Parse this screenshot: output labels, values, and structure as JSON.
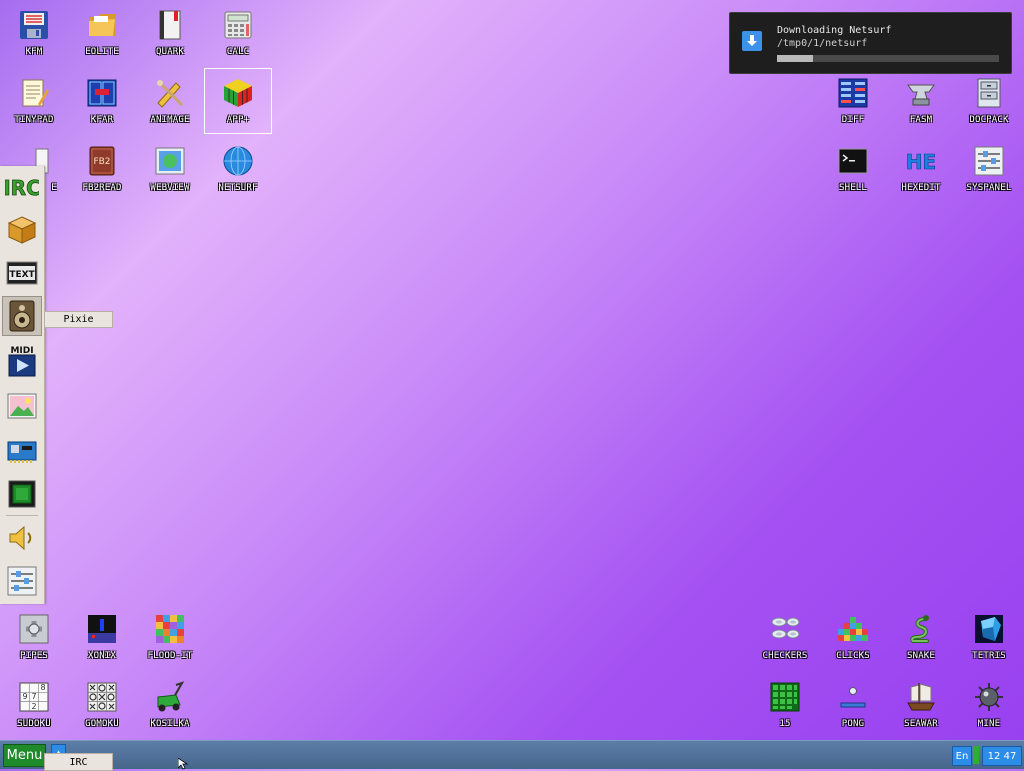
{
  "desktop": {
    "top_left": [
      {
        "label": "KFM",
        "icon": "floppy-icon"
      },
      {
        "label": "EOLITE",
        "icon": "folder-icon"
      },
      {
        "label": "QUARK",
        "icon": "book-icon"
      },
      {
        "label": "CALC",
        "icon": "calculator-icon"
      },
      {
        "label": "TINYPAD",
        "icon": "notepad-icon"
      },
      {
        "label": "KFAR",
        "icon": "panels-icon"
      },
      {
        "label": "ANIMAGE",
        "icon": "pencil-icon"
      },
      {
        "label": "APP+",
        "icon": "rubik-cube-icon"
      },
      {
        "label": "E",
        "icon": "text-doc-icon"
      },
      {
        "label": "FB2READ",
        "icon": "fb2-book-icon"
      },
      {
        "label": "WEBVIEW",
        "icon": "webpage-icon"
      },
      {
        "label": "NETSURF",
        "icon": "globe-icon"
      }
    ],
    "top_right": [
      {
        "label": "DIFF",
        "icon": "diff-icon"
      },
      {
        "label": "FASM",
        "icon": "anvil-icon"
      },
      {
        "label": "DOCPACK",
        "icon": "cabinet-icon"
      },
      {
        "label": "SHELL",
        "icon": "terminal-icon"
      },
      {
        "label": "HEXEDIT",
        "icon": "hex-icon"
      },
      {
        "label": "SYSPANEL",
        "icon": "sliders-icon"
      }
    ],
    "bottom_left": [
      {
        "label": "PIPES",
        "icon": "pipes-icon"
      },
      {
        "label": "XONIX",
        "icon": "xonix-icon"
      },
      {
        "label": "FLOOD-IT",
        "icon": "flood-grid-icon"
      },
      {
        "label": "SUDOKU",
        "icon": "sudoku-icon"
      },
      {
        "label": "GOMOKU",
        "icon": "gomoku-icon"
      },
      {
        "label": "KOSILKA",
        "icon": "lawnmower-icon"
      }
    ],
    "bottom_right": [
      {
        "label": "CHECKERS",
        "icon": "checkers-icon"
      },
      {
        "label": "CLICKS",
        "icon": "clicks-icon"
      },
      {
        "label": "SNAKE",
        "icon": "snake-icon"
      },
      {
        "label": "TETRIS",
        "icon": "tetris-icon"
      },
      {
        "label": "15",
        "icon": "fifteen-icon"
      },
      {
        "label": "PONG",
        "icon": "pong-icon"
      },
      {
        "label": "SEAWAR",
        "icon": "ship-icon"
      },
      {
        "label": "MINE",
        "icon": "mine-icon"
      }
    ]
  },
  "dock": {
    "items": [
      {
        "icon": "irc-icon",
        "label": "IRC"
      },
      {
        "icon": "package-box-icon"
      },
      {
        "icon": "text-tool-icon",
        "label": "TEXT"
      },
      {
        "icon": "speaker-player-icon"
      },
      {
        "icon": "midi-player-icon",
        "label": "MIDI"
      },
      {
        "icon": "image-viewer-icon"
      },
      {
        "icon": "network-card-icon"
      },
      {
        "icon": "cpu-chip-icon"
      },
      {
        "icon": "volume-icon"
      },
      {
        "icon": "settings-sliders-icon"
      }
    ],
    "tooltip": "Pixie"
  },
  "notification": {
    "title": "Downloading Netsurf",
    "path": "/tmp0/1/netsurf",
    "progress": 0.16
  },
  "taskbar": {
    "menu_label": "Menu",
    "task_label": "IRC",
    "language": "En",
    "clock": "12 47"
  },
  "colors": {
    "menu_green": "#1f8a2a",
    "accent_blue": "#2c8ce8",
    "notify_bg": "#1e1e1e"
  }
}
